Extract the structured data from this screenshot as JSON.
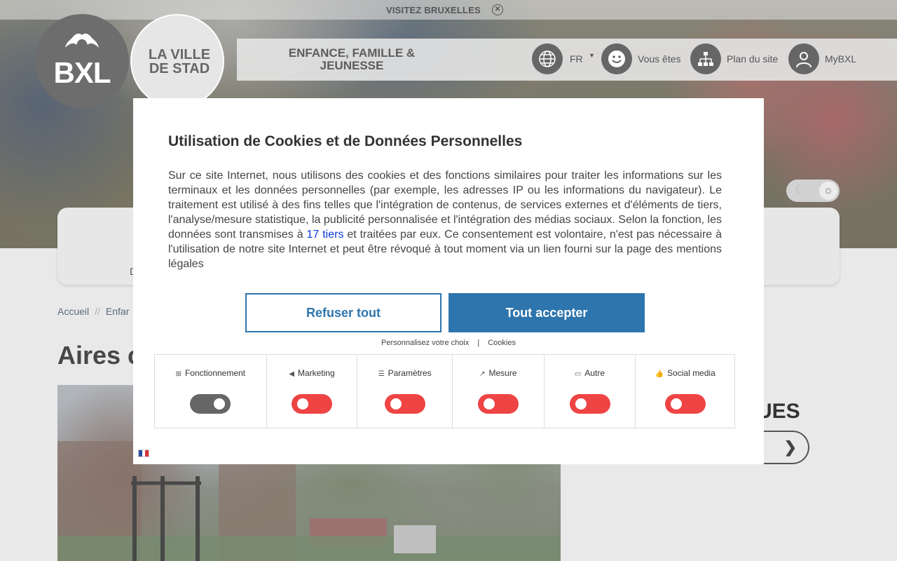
{
  "topbar": {
    "visit_label": "VISITEZ BRUXELLES",
    "close_icon": "close-circle-icon"
  },
  "logo": {
    "bxl": "BXL",
    "ville_line1": "LA VILLE",
    "ville_line2": "DE STAD"
  },
  "header": {
    "section_line1": "ENFANCE, FAMILLE &",
    "section_line2": "JEUNESSE",
    "lang": "FR",
    "vous_etes": "Vous êtes",
    "plan": "Plan du site",
    "mybxl": "MyBXL"
  },
  "card": {
    "partial_text": "D"
  },
  "breadcrumb": {
    "home": "Accueil",
    "sep": "//",
    "current": "Enfar"
  },
  "page": {
    "title": "Aires c",
    "side_heading": "UES"
  },
  "modal": {
    "title": "Utilisation de Cookies et de Données Personnelles",
    "body_before": "Sur ce site Internet, nous utilisons des cookies et des fonctions similaires pour traiter les informations sur les terminaux et les données personnelles (par exemple, les adresses IP ou les informations du navigateur). Le traitement est utilisé à des fins telles que l'intégration de contenus, de services externes et d'éléments de tiers, l'analyse/mesure statistique, la publicité personnalisée et l'intégration des médias sociaux. Selon la fonction, les données sont transmises à ",
    "body_link": "17 tiers",
    "body_after": " et traitées par eux. Ce consentement est volontaire, n'est pas nécessaire à l'utilisation de notre site Internet et peut être révoqué à tout moment via un lien fourni sur la page des mentions légales",
    "refuse": "Refuser tout",
    "accept": "Tout accepter",
    "customize": "Personnalisez votre choix",
    "separator": "|",
    "cookies": "Cookies",
    "categories": [
      {
        "label": "Fonctionnement",
        "icon": "grid-icon",
        "enabled": true
      },
      {
        "label": "Marketing",
        "icon": "megaphone-icon",
        "enabled": false
      },
      {
        "label": "Paramètres",
        "icon": "sliders-icon",
        "enabled": false
      },
      {
        "label": "Mesure",
        "icon": "chart-icon",
        "enabled": false
      },
      {
        "label": "Autre",
        "icon": "chat-icon",
        "enabled": false
      },
      {
        "label": "Social media",
        "icon": "thumbs-up-icon",
        "enabled": false
      }
    ],
    "colors": {
      "accent": "#2e75ad",
      "toggle_off": "#ee4444",
      "toggle_on": "#666666",
      "link": "#0b3bd6"
    }
  }
}
